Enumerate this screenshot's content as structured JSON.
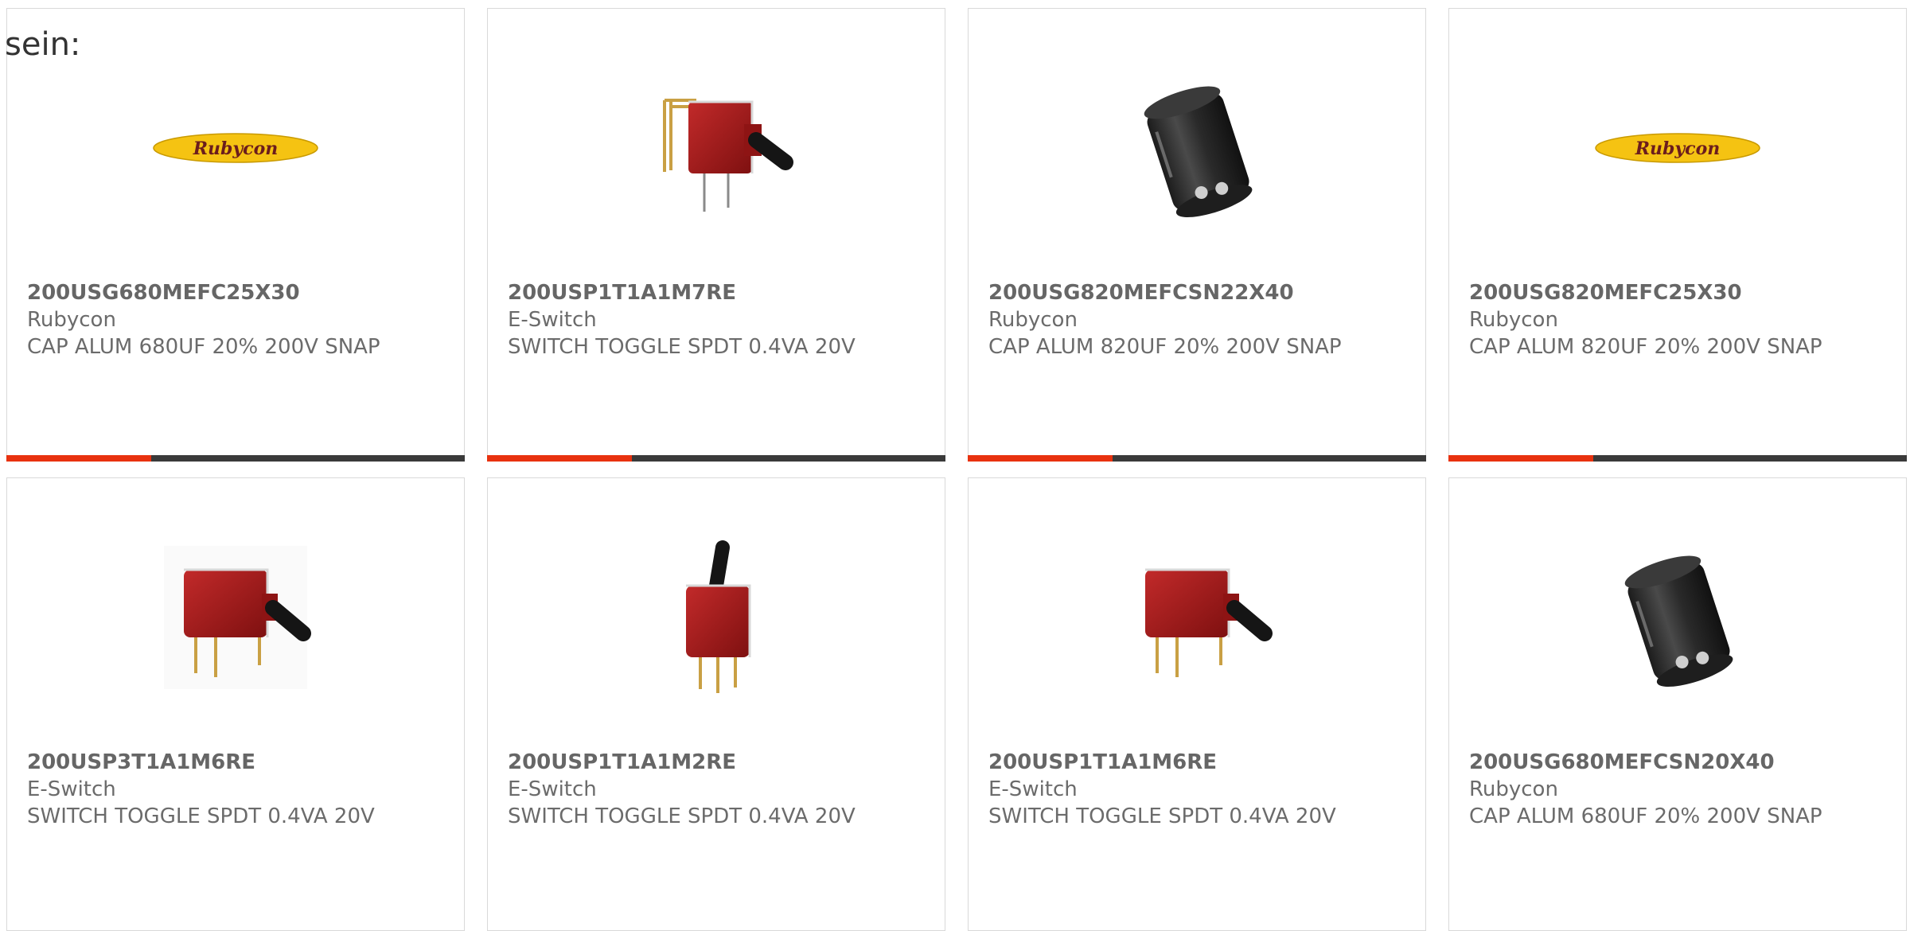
{
  "intro_text": "sein:",
  "colors": {
    "accent": "#e8320f",
    "bar": "#3a3a3a",
    "text": "#6b6b6b",
    "border": "#d9d9d9"
  },
  "products": [
    {
      "part": "200USG680MEFC25X30",
      "mfr": "Rubycon",
      "desc": "CAP ALUM 680UF 20% 200V SNAP",
      "image": "rubycon-logo"
    },
    {
      "part": "200USP1T1A1M7RE",
      "mfr": "E-Switch",
      "desc": "SWITCH TOGGLE SPDT 0.4VA 20V",
      "image": "toggle-switch-right-angle"
    },
    {
      "part": "200USG820MEFCSN22X40",
      "mfr": "Rubycon",
      "desc": "CAP ALUM 820UF 20% 200V SNAP",
      "image": "electrolytic-capacitor"
    },
    {
      "part": "200USG820MEFC25X30",
      "mfr": "Rubycon",
      "desc": "CAP ALUM 820UF 20% 200V SNAP",
      "image": "rubycon-logo"
    },
    {
      "part": "200USP3T1A1M6RE",
      "mfr": "E-Switch",
      "desc": "SWITCH TOGGLE SPDT 0.4VA 20V",
      "image": "toggle-switch-horizontal"
    },
    {
      "part": "200USP1T1A1M2RE",
      "mfr": "E-Switch",
      "desc": "SWITCH TOGGLE SPDT 0.4VA 20V",
      "image": "toggle-switch-vertical"
    },
    {
      "part": "200USP1T1A1M6RE",
      "mfr": "E-Switch",
      "desc": "SWITCH TOGGLE SPDT 0.4VA 20V",
      "image": "toggle-switch-horizontal"
    },
    {
      "part": "200USG680MEFCSN20X40",
      "mfr": "Rubycon",
      "desc": "CAP ALUM 680UF 20% 200V SNAP",
      "image": "electrolytic-capacitor"
    }
  ],
  "logo_text": "Rubycon"
}
